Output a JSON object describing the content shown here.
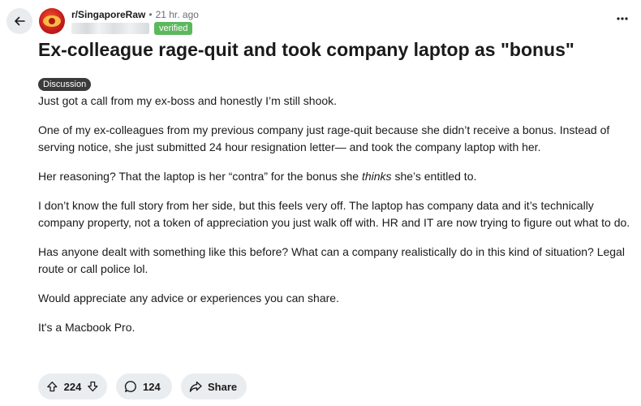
{
  "post": {
    "subreddit": "r/SingaporeRaw",
    "separator": "•",
    "time_ago": "21 hr. ago",
    "user_badge": "verified",
    "title": "Ex-colleague rage-quit and took company laptop as \"bonus\"",
    "flair": "Discussion",
    "body": {
      "p1": "Just got a call from my ex-boss and honestly I’m still shook.",
      "p2": "One of my ex-colleagues from my previous company just rage-quit because she didn’t receive a bonus. Instead of serving notice, she just submitted 24 hour resignation letter— and took the company laptop with her.",
      "p3_before": "Her reasoning? That the laptop is her “contra” for the bonus she ",
      "p3_em": "thinks",
      "p3_after": " she’s entitled to.",
      "p4": "I don’t know the full story from her side, but this feels very off. The laptop has company data and it’s technically company property, not a token of appreciation you just walk off with. HR and IT are now trying to figure out what to do.",
      "p5": "Has anyone dealt with something like this before? What can a company realistically do in this kind of situation? Legal route or call police lol.",
      "p6": "Would appreciate any advice or experiences you can share.",
      "p7": "It's a Macbook Pro."
    },
    "votes": "224",
    "comments": "124",
    "share_label": "Share"
  },
  "icons": {
    "back": "arrow-left-icon",
    "more": "more-horizontal-icon",
    "upvote": "arrow-up-icon",
    "downvote": "arrow-down-icon",
    "comment": "speech-bubble-icon",
    "share": "share-arrow-icon"
  },
  "colors": {
    "verified_badge": "#5cb85c",
    "flair_bg": "#3b3b3b",
    "pill_bg": "#eaedef",
    "subreddit_avatar": "#c81e1e"
  }
}
